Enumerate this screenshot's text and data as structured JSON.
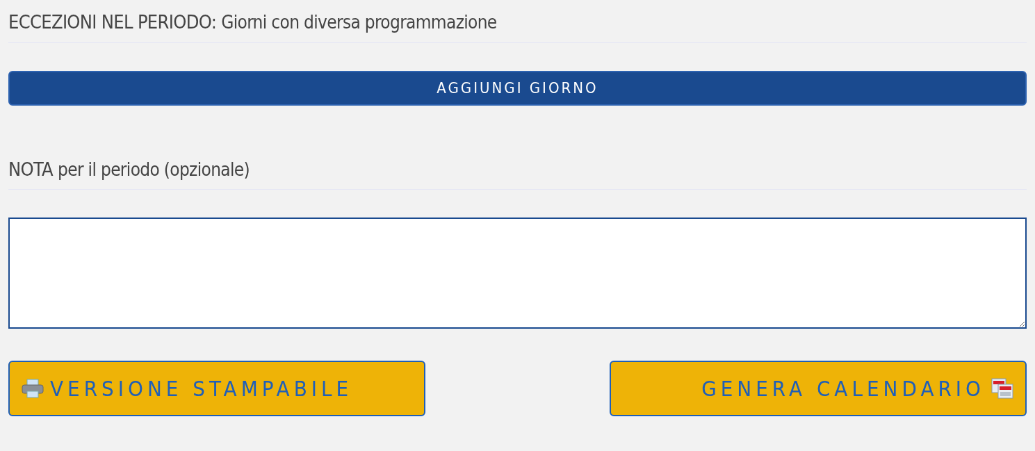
{
  "exceptions_heading": {
    "title": "ECCEZIONI NEL PERIODO:",
    "subtitle": "Giorni con diversa programmazione"
  },
  "add_day_button": "AGGIUNGI GIORNO",
  "note_heading": {
    "title": "NOTA",
    "subtitle": "per il periodo (opzionale)"
  },
  "actions": [
    {
      "kind": "print",
      "label": "VERSIONE STAMPABILE"
    },
    {
      "kind": "calendar",
      "label": "GENERA CALENDARIO"
    }
  ]
}
